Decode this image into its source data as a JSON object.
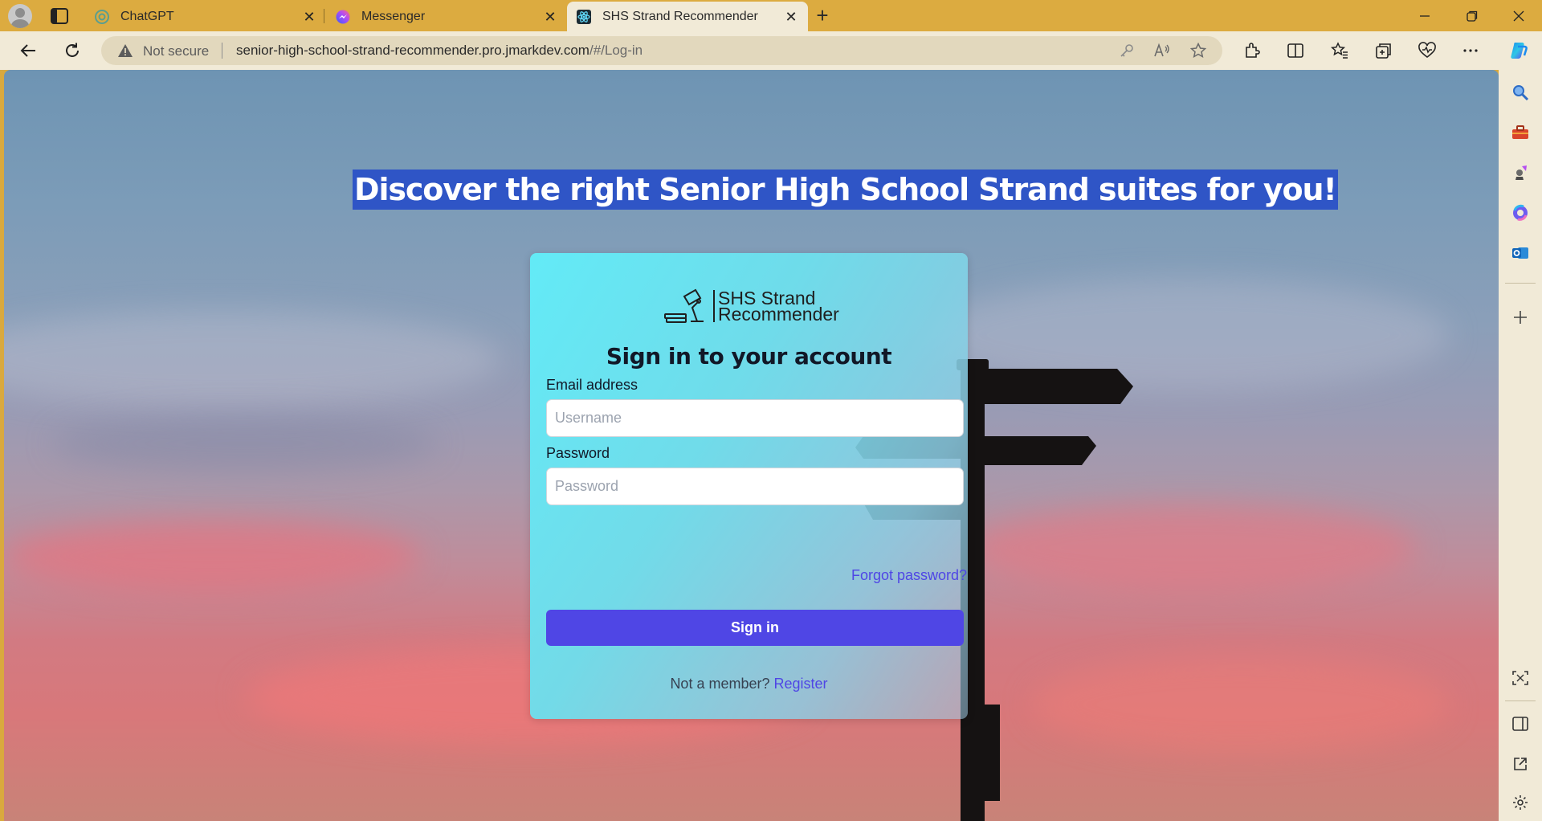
{
  "browser": {
    "tabs": [
      {
        "title": "ChatGPT",
        "icon": "chatgpt-icon",
        "active": false
      },
      {
        "title": "Messenger",
        "icon": "messenger-icon",
        "active": false
      },
      {
        "title": "SHS Strand Recommender",
        "icon": "react-icon",
        "active": true
      }
    ],
    "security_label": "Not secure",
    "url_host": "senior-high-school-strand-recommender.pro.jmarkdev.com",
    "url_path": "/#/Log-in",
    "colors": {
      "frame": "#dcab40",
      "toolbar": "#f1ead7"
    }
  },
  "page": {
    "headline": "Discover the right Senior High School Strand suites for you!",
    "logo_line1": "SHS Strand",
    "logo_line2": "Recommender",
    "card_title": "Sign in to your account",
    "email_label": "Email address",
    "email_placeholder": "Username",
    "password_label": "Password",
    "password_placeholder": "Password",
    "forgot_link": "Forgot password?",
    "signin_button": "Sign in",
    "member_text": "Not a member?",
    "register_link": "Register",
    "colors": {
      "primary": "#4f46e5",
      "card_start": "#62ecf8",
      "headline_highlight": "#2f55c6"
    }
  }
}
